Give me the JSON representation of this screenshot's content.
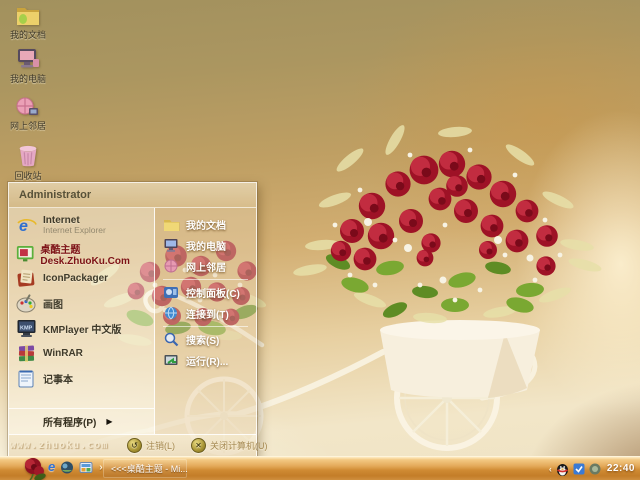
{
  "desktop": {
    "watermark": "www.zhuoku.com",
    "icons": [
      {
        "label": "我的文档",
        "icon": "my-documents-icon"
      },
      {
        "label": "我的电脑",
        "icon": "my-computer-icon"
      },
      {
        "label": "网上邻居",
        "icon": "network-places-icon"
      },
      {
        "label": "回收站",
        "icon": "recycle-bin-icon"
      }
    ]
  },
  "start_menu": {
    "user_name": "Administrator",
    "left_column": {
      "items": [
        {
          "title": "Internet",
          "subtitle": "Internet Explorer",
          "icon": "internet-explorer-icon"
        },
        {
          "title": "桌酷主题Desk.ZhuoKu.Com",
          "icon": "zhuoku-theme-icon"
        },
        {
          "title": "IconPackager",
          "icon": "iconpackager-icon"
        },
        {
          "title": "画图",
          "icon": "paint-icon"
        },
        {
          "title": "KMPlayer 中文版",
          "icon": "kmplayer-icon"
        },
        {
          "title": "WinRAR",
          "icon": "winrar-icon"
        },
        {
          "title": "记事本",
          "icon": "notepad-icon"
        }
      ],
      "all_programs": "所有程序(P)",
      "all_programs_arrow": "▶"
    },
    "right_column": {
      "items": [
        {
          "label": "我的文档",
          "icon": "my-documents-icon"
        },
        {
          "label": "我的电脑",
          "icon": "my-computer-icon"
        },
        {
          "label": "网上邻居",
          "icon": "network-places-icon"
        },
        {
          "label": "控制面板(C)",
          "icon": "control-panel-icon"
        },
        {
          "label": "连接到(T)",
          "icon": "connect-to-icon"
        },
        {
          "label": "搜索(S)",
          "icon": "search-icon"
        },
        {
          "label": "运行(R)...",
          "icon": "run-icon"
        }
      ]
    },
    "footer": {
      "log_off": "注销(L)",
      "log_off_glyph": "↺",
      "shut_down": "关闭计算机(U)",
      "shut_down_glyph": "✕"
    }
  },
  "taskbar": {
    "ie_glyph": "e",
    "quick_launch_overflow": "›",
    "task_button_label": "<<<桌酷主题 - Mi...",
    "tray_collapse": "‹",
    "clock": "22:40"
  },
  "colors": {
    "rose_red": "#a8142a",
    "taskbar_orange": "#d8993f",
    "menu_text_dark": "#3f3a2a",
    "menu_text_white": "#ffffff",
    "zhuoku_link": "#7d1216"
  }
}
